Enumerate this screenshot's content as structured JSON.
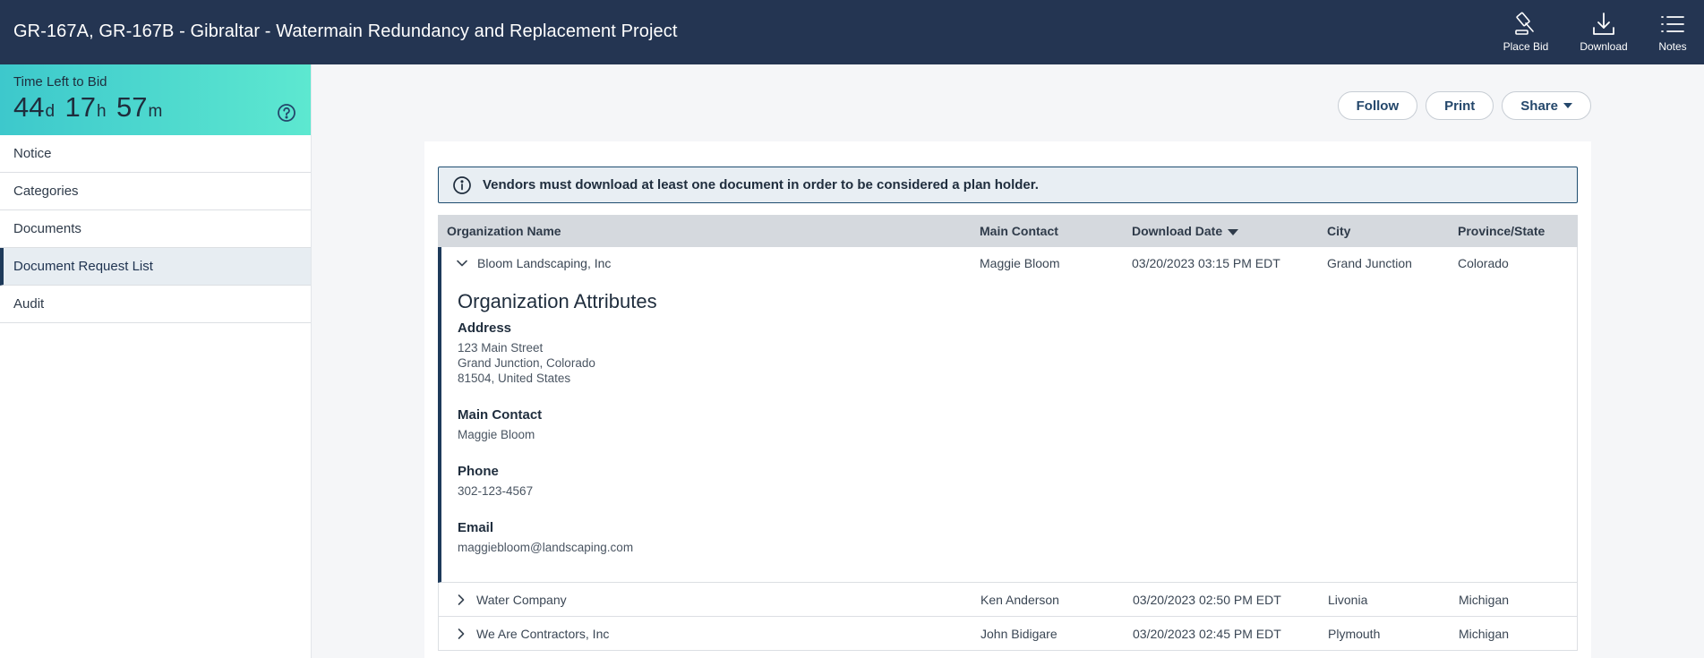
{
  "header": {
    "title": "GR-167A, GR-167B - Gibraltar - Watermain Redundancy and Replacement Project",
    "actions": {
      "place_bid": "Place Bid",
      "download": "Download",
      "notes": "Notes"
    }
  },
  "timer": {
    "label": "Time Left to Bid",
    "days": "44",
    "days_unit": "d",
    "hours": "17",
    "hours_unit": "h",
    "minutes": "57",
    "minutes_unit": "m"
  },
  "sidebar": {
    "items": [
      {
        "label": "Notice"
      },
      {
        "label": "Categories"
      },
      {
        "label": "Documents"
      },
      {
        "label": "Document Request List"
      },
      {
        "label": "Audit"
      }
    ]
  },
  "toolbar": {
    "follow": "Follow",
    "print": "Print",
    "share": "Share"
  },
  "notice": {
    "text": "Vendors must download at least one document in order to be considered a plan holder."
  },
  "table": {
    "headers": [
      "Organization Name",
      "Main Contact",
      "Download Date",
      "City",
      "Province/State"
    ],
    "rows": [
      {
        "org": "Bloom Landscaping, Inc",
        "contact": "Maggie Bloom",
        "date": "03/20/2023 03:15 PM EDT",
        "city": "Grand Junction",
        "state": "Colorado"
      },
      {
        "org": "Water Company",
        "contact": "Ken Anderson",
        "date": "03/20/2023 02:50 PM EDT",
        "city": "Livonia",
        "state": "Michigan"
      },
      {
        "org": "We Are Contractors, Inc",
        "contact": "John Bidigare",
        "date": "03/20/2023 02:45 PM EDT",
        "city": "Plymouth",
        "state": "Michigan"
      }
    ]
  },
  "attributes": {
    "title": "Organization Attributes",
    "address_label": "Address",
    "address_line1": "123 Main Street",
    "address_line2": "Grand Junction, Colorado",
    "address_line3": "81504, United States",
    "contact_label": "Main Contact",
    "contact_value": "Maggie Bloom",
    "phone_label": "Phone",
    "phone_value": "302-123-4567",
    "email_label": "Email",
    "email_value": "maggiebloom@landscaping.com"
  },
  "colors": {
    "header_bg": "#243552",
    "timer_start": "#3dc8cc",
    "timer_end": "#5de8d0",
    "accent": "#1e3a5a"
  }
}
